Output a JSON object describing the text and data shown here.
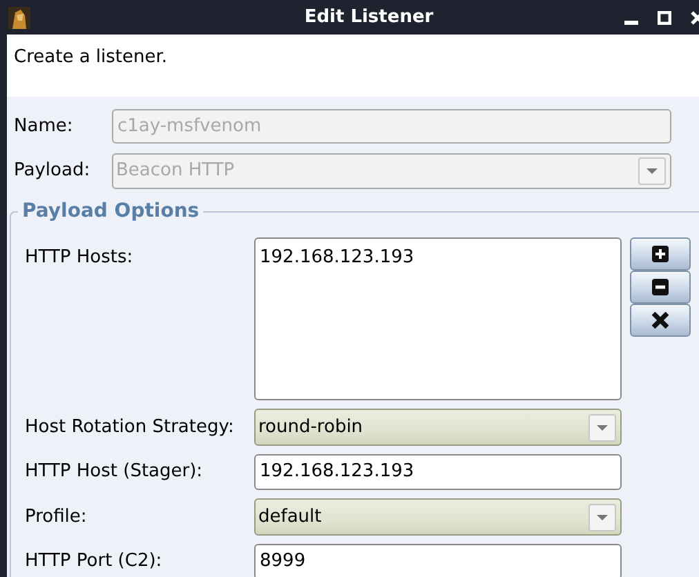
{
  "window": {
    "title": "Edit Listener"
  },
  "description": "Create a listener.",
  "fields": [
    {
      "label": "Name:",
      "kind": "text",
      "value": "c1ay-msfvenom",
      "disabled": true
    },
    {
      "label": "Payload:",
      "kind": "combo",
      "value": "Beacon HTTP",
      "disabled": true
    }
  ],
  "payload_options": {
    "title": "Payload Options",
    "fields": [
      {
        "label": "HTTP Hosts:",
        "kind": "list",
        "items": [
          "192.168.123.193"
        ],
        "buttons": [
          {
            "kind": "add"
          },
          {
            "kind": "remove"
          },
          {
            "kind": "clear"
          }
        ]
      },
      {
        "label": "Host Rotation Strategy:",
        "kind": "combo",
        "value": "round-robin",
        "disabled": false
      },
      {
        "label": "HTTP Host (Stager):",
        "kind": "text",
        "value": "192.168.123.193",
        "disabled": false
      },
      {
        "label": "Profile:",
        "kind": "combo",
        "value": "default",
        "disabled": false
      },
      {
        "label": "HTTP Port (C2):",
        "kind": "text",
        "value": "8999",
        "disabled": false
      }
    ]
  }
}
